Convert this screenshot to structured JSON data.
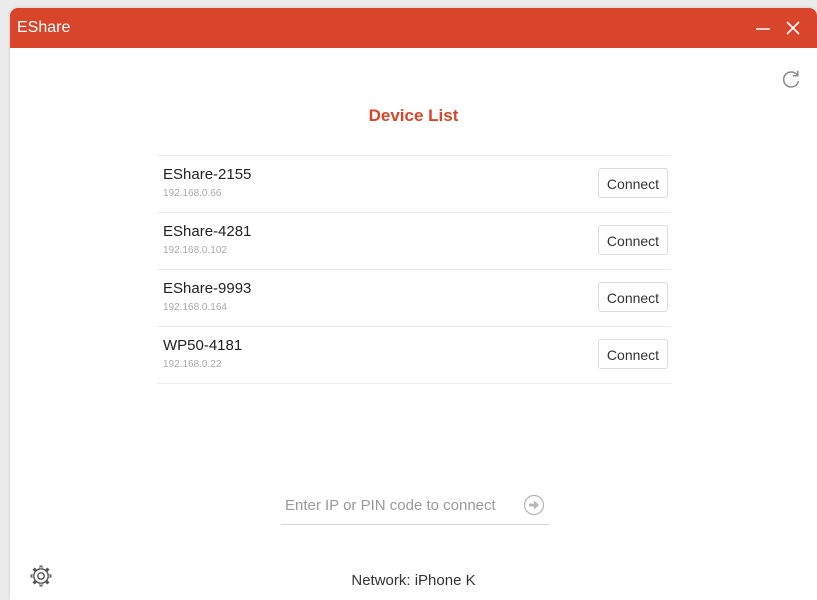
{
  "window": {
    "title": "EShare",
    "accent_color": "#d9452b",
    "controls": [
      "minimize-icon",
      "close-icon"
    ]
  },
  "toolbar": {
    "refresh_icon": "refresh-icon"
  },
  "device_list": {
    "title": "Device List",
    "devices": [
      {
        "name": "EShare-2155",
        "ip": "192.168.0.66",
        "action": "Connect"
      },
      {
        "name": "EShare-4281",
        "ip": "192.168.0.102",
        "action": "Connect"
      },
      {
        "name": "EShare-9993",
        "ip": "192.168.0.164",
        "action": "Connect"
      },
      {
        "name": "WP50-4181",
        "ip": "192.168.0.22",
        "action": "Connect"
      }
    ]
  },
  "pin_entry": {
    "placeholder": "Enter IP or PIN code to connect",
    "value": "",
    "submit_icon": "arrow-right-circle-icon"
  },
  "footer": {
    "settings_icon": "gear-icon",
    "network_label": "Network: iPhone K"
  }
}
